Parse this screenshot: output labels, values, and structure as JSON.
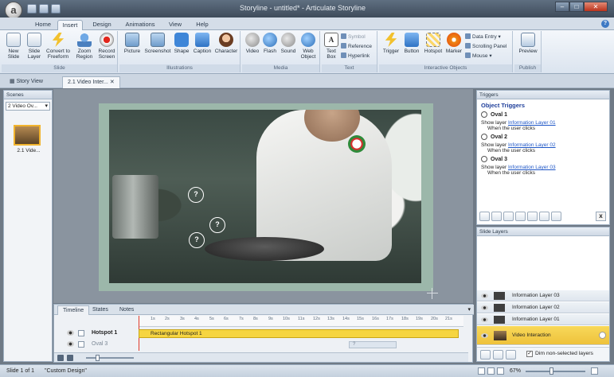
{
  "window": {
    "title": "Storyline - untitled* - Articulate Storyline"
  },
  "ribbon": {
    "tabs": [
      "Home",
      "Insert",
      "Design",
      "Animations",
      "View",
      "Help"
    ],
    "active_tab": "Insert",
    "groups": {
      "slide": {
        "label": "Slide",
        "buttons": [
          "New Slide",
          "Slide Layer",
          "Convert to Freeform",
          "Zoom Region",
          "Record Screen"
        ]
      },
      "illustrations": {
        "label": "Illustrations",
        "buttons": [
          "Picture",
          "Screenshot",
          "Shape",
          "Caption",
          "Character"
        ]
      },
      "media": {
        "label": "Media",
        "buttons": [
          "Video",
          "Flash",
          "Sound",
          "Web Object"
        ]
      },
      "text": {
        "label": "Text",
        "big": "Text Box",
        "small": [
          "Symbol",
          "Reference",
          "Hyperlink"
        ]
      },
      "interactive": {
        "label": "Interactive Objects",
        "buttons": [
          "Trigger",
          "Button",
          "Hotspot",
          "Marker"
        ],
        "small": [
          "Data Entry",
          "Scrolling Panel",
          "Mouse"
        ]
      },
      "publish": {
        "label": "Publish",
        "buttons": [
          "Preview"
        ]
      }
    }
  },
  "doc_tabs": {
    "story_view": "Story View",
    "slide_tab": "2.1 Video Inter..."
  },
  "scenes": {
    "header": "Scenes",
    "selected": "2 Video Ov...",
    "thumb_label": "2.1 Vide..."
  },
  "stage": {
    "hotspot_marks": [
      "?",
      "?",
      "?"
    ]
  },
  "timeline": {
    "tabs": [
      "Timeline",
      "States",
      "Notes"
    ],
    "ticks": [
      "1s",
      "2s",
      "3s",
      "4s",
      "5s",
      "6s",
      "7s",
      "8s",
      "9s",
      "10s",
      "11s",
      "12s",
      "13s",
      "14s",
      "15s",
      "16s",
      "17s",
      "18s",
      "19s",
      "20s",
      "21s"
    ],
    "rows": [
      {
        "name": "Hotspot 1",
        "bar": "Rectangular Hotspot 1"
      },
      {
        "name": "Oval 3",
        "bar": "?"
      }
    ]
  },
  "triggers": {
    "header": "Triggers",
    "title": "Object Triggers",
    "items": [
      {
        "oval": "Oval 1",
        "action": "Show layer",
        "target": "Information Layer 01",
        "when": "When the user clicks"
      },
      {
        "oval": "Oval 2",
        "action": "Show layer",
        "target": "Information Layer 02",
        "when": "When the user clicks"
      },
      {
        "oval": "Oval 3",
        "action": "Show layer",
        "target": "Information Layer 03",
        "when": "When the user clicks"
      }
    ],
    "close_label": "x"
  },
  "layers": {
    "header": "Slide Layers",
    "items": [
      "Information Layer 03",
      "Information Layer 02",
      "Information Layer 01"
    ],
    "base": "Video Interaction",
    "dim_label": "Dim non-selected layers",
    "dim_checked": true
  },
  "status": {
    "slide": "Slide 1 of 1",
    "theme": "\"Custom Design\"",
    "zoom": "67%"
  },
  "colors": {
    "accent": "#f6d541",
    "link": "#1f57c7",
    "trigger_title": "#1e3e9a"
  }
}
